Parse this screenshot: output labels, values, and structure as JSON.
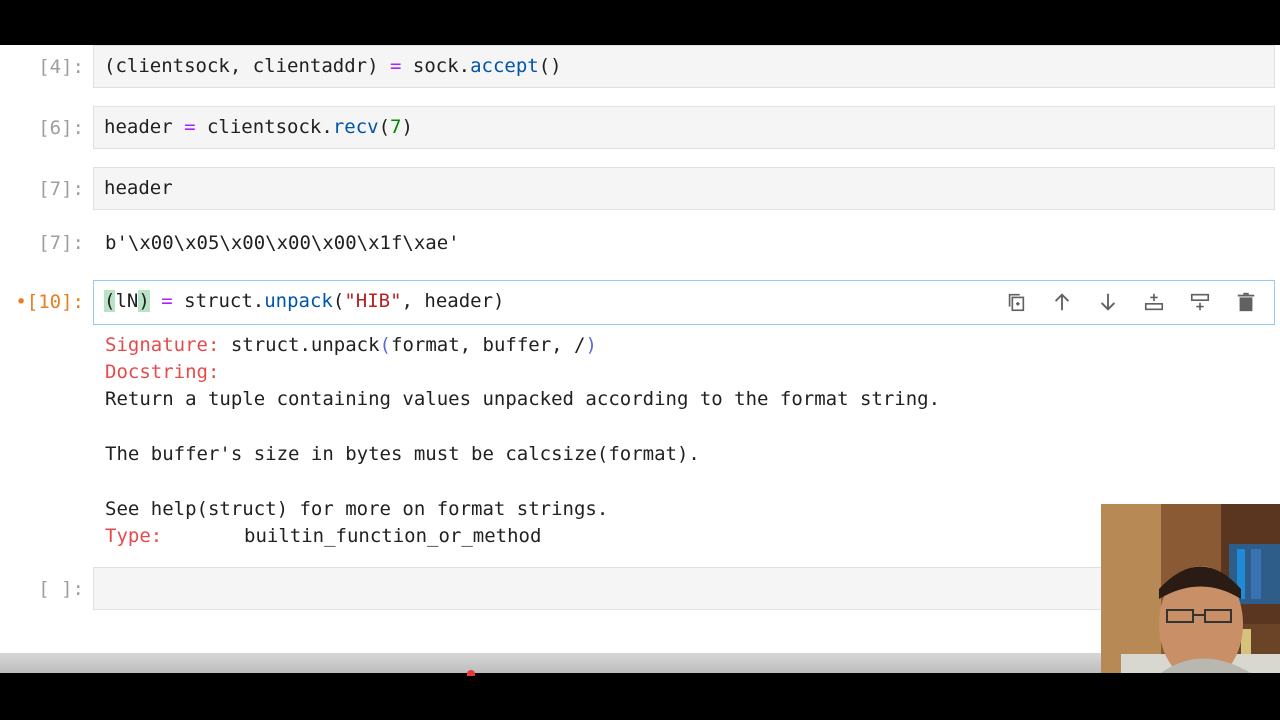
{
  "cells": {
    "c4": {
      "prompt": "[4]:",
      "code": {
        "a": "(clientsock, clientaddr) ",
        "eq": "=",
        "b": " sock.",
        "fn": "accept",
        "c": "()"
      }
    },
    "c6": {
      "prompt": "[6]:",
      "code": {
        "a": "header ",
        "eq": "=",
        "b": " clientsock.",
        "fn": "recv",
        "c": "(",
        "num": "7",
        "d": ")"
      }
    },
    "c7": {
      "prompt": "[7]:",
      "code": "header",
      "out_prompt": "[7]:",
      "output": "b'\\x00\\x05\\x00\\x00\\x00\\x1f\\xae'"
    },
    "c10": {
      "prompt": "•[10]:",
      "code": {
        "hl_open": "(",
        "mid": "lN",
        "hl_close": ")",
        "sp": " ",
        "eq": "=",
        "b": " struct.",
        "fn": "unpack",
        "c": "(",
        "str": "\"HIB\"",
        "d": ", header)"
      }
    },
    "empty": {
      "prompt": "[ ]:"
    }
  },
  "help": {
    "sig_label": "Signature:",
    "sig_fn": " struct.unpack",
    "sig_open": "(",
    "sig_args": "format, buffer, /",
    "sig_close": ")",
    "doc_label": "Docstring:",
    "line1": "Return a tuple containing values unpacked according to the format string.",
    "line2": "The buffer's size in bytes must be calcsize(format).",
    "line3": "See help(struct) for more on format strings.",
    "type_label": "Type:",
    "type_value": "builtin_function_or_method"
  },
  "toolbar": [
    "copy-icon",
    "move-up-icon",
    "move-down-icon",
    "insert-below-icon",
    "insert-above-icon",
    "delete-icon"
  ],
  "colors": {
    "active_prompt": "#e67e22",
    "keyword": "#aa22ff",
    "function": "#0055aa",
    "number": "#008800",
    "string": "#ba2121",
    "help_label": "#e54b4b"
  }
}
